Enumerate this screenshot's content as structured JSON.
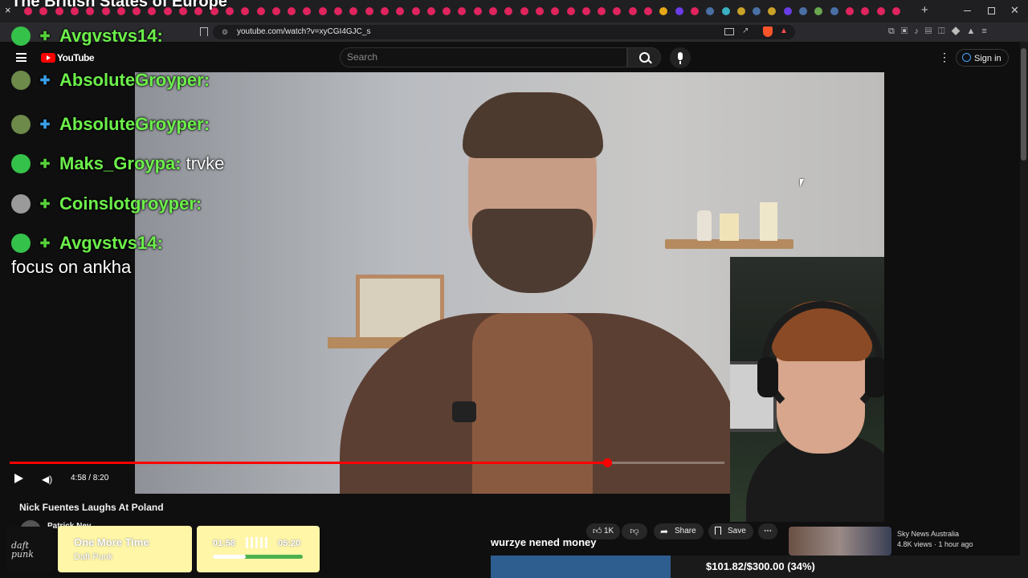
{
  "page_title": "The British States of Europe",
  "browser": {
    "url": "youtube.com/watch?v=xyCGI4GJC_s",
    "new_tab_glyph": "+",
    "close_tab_glyph": "×"
  },
  "youtube": {
    "logo_text": "YouTube",
    "search_placeholder": "Search",
    "sign_in_label": "Sign in"
  },
  "chat": [
    {
      "user": "Avgvstvs14:",
      "message": "",
      "badge_colors": [
        "#35c24a",
        "#55d13a"
      ]
    },
    {
      "user": "AbsoluteGroyper:",
      "message": "",
      "badge_colors": [
        "#6d8a4b",
        "#3aa0e8"
      ]
    },
    {
      "user": "AbsoluteGroyper:",
      "message": "",
      "badge_colors": [
        "#6d8a4b",
        "#3aa0e8"
      ]
    },
    {
      "user": "Maks_Groypa:",
      "message": "trvke",
      "badge_colors": [
        "#35c24a",
        "#55d13a"
      ]
    },
    {
      "user": "Coinslotgroyper:",
      "message": "",
      "badge_colors": [
        "#9a9a9a",
        "#55d13a"
      ]
    },
    {
      "user": "Avgvstvs14:",
      "message": "focus on ankha",
      "badge_colors": [
        "#35c24a",
        "#55d13a"
      ]
    }
  ],
  "player": {
    "time_display": "4:58 / 8:20",
    "progress_fraction": 0.836
  },
  "video": {
    "title": "Nick Fuentes Laughs At Poland",
    "channel": "Patrick Ney",
    "likes": "1K",
    "share_label": "Share",
    "save_label": "Save"
  },
  "now_playing": {
    "song": "One More Time",
    "artist": "Daft Punk",
    "elapsed": "01:58",
    "duration": "05:20",
    "album_text": "daft punk",
    "progress_fraction": 0.37
  },
  "stream_caption": "wurzye nened money",
  "goal": {
    "text": "$101.82/$300.00 (34%)",
    "fraction": 0.34
  },
  "sidebar_recommendation": {
    "channel": "Sky News Australia",
    "meta": "4.8K views · 1 hour ago"
  },
  "colors": {
    "chat_username": "#6cf04a",
    "progress_red": "#ff0000",
    "widget_yellow": "#fff6a8",
    "goal_fill": "#2e5d8f"
  }
}
